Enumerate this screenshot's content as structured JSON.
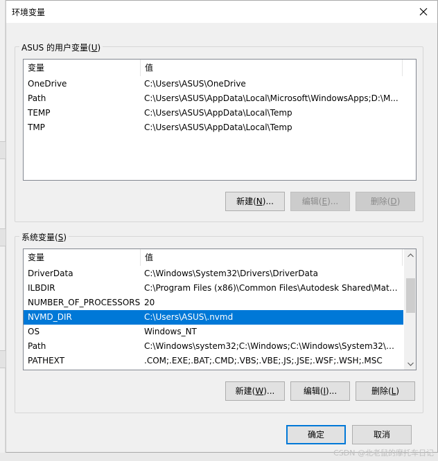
{
  "window": {
    "title": "环境变量"
  },
  "user_vars": {
    "group_label": "ASUS 的用户变量(",
    "group_label_key": "U",
    "group_label_end": ")",
    "columns": [
      "变量",
      "值"
    ],
    "rows": [
      {
        "name": "OneDrive",
        "value": "C:\\Users\\ASUS\\OneDrive"
      },
      {
        "name": "Path",
        "value": "C:\\Users\\ASUS\\AppData\\Local\\Microsoft\\WindowsApps;D:\\M..."
      },
      {
        "name": "TEMP",
        "value": "C:\\Users\\ASUS\\AppData\\Local\\Temp"
      },
      {
        "name": "TMP",
        "value": "C:\\Users\\ASUS\\AppData\\Local\\Temp"
      }
    ],
    "buttons": {
      "new": {
        "label": "新建(",
        "key": "N",
        "end": ")..."
      },
      "edit": {
        "label": "编辑(",
        "key": "E",
        "end": ")..."
      },
      "delete": {
        "label": "删除(",
        "key": "D",
        "end": ")"
      }
    }
  },
  "system_vars": {
    "group_label": "系统变量(",
    "group_label_key": "S",
    "group_label_end": ")",
    "columns": [
      "变量",
      "值"
    ],
    "rows": [
      {
        "name": "DriverData",
        "value": "C:\\Windows\\System32\\Drivers\\DriverData"
      },
      {
        "name": "ILBDIR",
        "value": "C:\\Program Files (x86)\\Common Files\\Autodesk Shared\\Mate..."
      },
      {
        "name": "NUMBER_OF_PROCESSORS",
        "value": "20"
      },
      {
        "name": "NVMD_DIR",
        "value": "C:\\Users\\ASUS\\.nvmd",
        "selected": true
      },
      {
        "name": "OS",
        "value": "Windows_NT"
      },
      {
        "name": "Path",
        "value": "C:\\Windows\\system32;C:\\Windows;C:\\Windows\\System32\\Wb..."
      },
      {
        "name": "PATHEXT",
        "value": ".COM;.EXE;.BAT;.CMD;.VBS;.VBE;.JS;.JSE;.WSF;.WSH;.MSC"
      }
    ],
    "buttons": {
      "new": {
        "label": "新建(",
        "key": "W",
        "end": ")..."
      },
      "edit": {
        "label": "编辑(",
        "key": "I",
        "end": ")..."
      },
      "delete": {
        "label": "删除(",
        "key": "L",
        "end": ")"
      }
    }
  },
  "footer": {
    "ok": "确定",
    "cancel": "取消"
  },
  "watermark": "CSDN @北老鼠的摩托车日记",
  "icons": {
    "close": "close-icon",
    "scroll_up": "chevron-up-icon",
    "scroll_down": "chevron-down-icon"
  },
  "colors": {
    "selection": "#0078d7",
    "primary_border": "#0078d7",
    "dialog_bg": "#f0f0f0"
  }
}
